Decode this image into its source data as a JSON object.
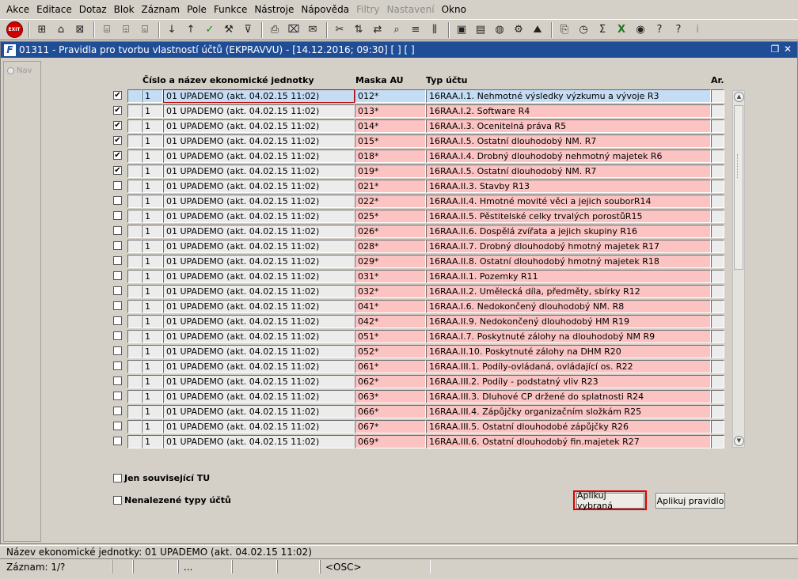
{
  "menu": [
    "Akce",
    "Editace",
    "Dotaz",
    "Blok",
    "Záznam",
    "Pole",
    "Funkce",
    "Nástroje",
    "Nápověda",
    "Filtry",
    "Nastavení",
    "Okno"
  ],
  "menu_disabled": [
    "Filtry",
    "Nastavení"
  ],
  "toolbar": {
    "exit_label": "EXIT"
  },
  "window": {
    "title": "01311 - Pravidla pro tvorbu vlastností účtů (EKPRAVVU) - [14.12.2016; 09:30] [ ] [ ]",
    "nav_label": "Nav"
  },
  "grid": {
    "columns": {
      "unit": "Číslo a název ekonomické jednotky",
      "mask": "Maska AU",
      "type": "Typ účtu",
      "ar": "Ar."
    },
    "rows": [
      {
        "checked": true,
        "num": "1",
        "unit": "01 UPADEMO (akt. 04.02.15 11:02)",
        "mask": "012*",
        "type": "16RAA.I.1.  Nehmotné výsledky výzkumu a vývoje R3"
      },
      {
        "checked": true,
        "num": "1",
        "unit": "01 UPADEMO (akt. 04.02.15 11:02)",
        "mask": "013*",
        "type": "16RAA.I.2.  Software R4"
      },
      {
        "checked": true,
        "num": "1",
        "unit": "01 UPADEMO (akt. 04.02.15 11:02)",
        "mask": "014*",
        "type": "16RAA.I.3.  Ocenitelná práva R5"
      },
      {
        "checked": true,
        "num": "1",
        "unit": "01 UPADEMO (akt. 04.02.15 11:02)",
        "mask": "015*",
        "type": "16RAA.I.5.  Ostatní dlouhodobý NM. R7"
      },
      {
        "checked": true,
        "num": "1",
        "unit": "01 UPADEMO (akt. 04.02.15 11:02)",
        "mask": "018*",
        "type": "16RAA.I.4.  Drobný dlouhodobý nehmotný majetek R6"
      },
      {
        "checked": true,
        "num": "1",
        "unit": "01 UPADEMO (akt. 04.02.15 11:02)",
        "mask": "019*",
        "type": "16RAA.I.5.  Ostatní dlouhodobý NM. R7"
      },
      {
        "checked": false,
        "num": "1",
        "unit": "01 UPADEMO (akt. 04.02.15 11:02)",
        "mask": "021*",
        "type": "16RAA.II.3.  Stavby R13"
      },
      {
        "checked": false,
        "num": "1",
        "unit": "01 UPADEMO (akt. 04.02.15 11:02)",
        "mask": "022*",
        "type": "16RAA.II.4.  Hmotné movité věci a jejich souborR14"
      },
      {
        "checked": false,
        "num": "1",
        "unit": "01 UPADEMO (akt. 04.02.15 11:02)",
        "mask": "025*",
        "type": "16RAA.II.5.  Pěstitelské celky trvalých porostůR15"
      },
      {
        "checked": false,
        "num": "1",
        "unit": "01 UPADEMO (akt. 04.02.15 11:02)",
        "mask": "026*",
        "type": "16RAA.II.6.  Dospělá zvířata a jejich skupiny R16"
      },
      {
        "checked": false,
        "num": "1",
        "unit": "01 UPADEMO (akt. 04.02.15 11:02)",
        "mask": "028*",
        "type": "16RAA.II.7.  Drobný dlouhodobý hmotný majetek R17"
      },
      {
        "checked": false,
        "num": "1",
        "unit": "01 UPADEMO (akt. 04.02.15 11:02)",
        "mask": "029*",
        "type": "16RAA.II.8.  Ostatní dlouhodobý hmotný majetek R18"
      },
      {
        "checked": false,
        "num": "1",
        "unit": "01 UPADEMO (akt. 04.02.15 11:02)",
        "mask": "031*",
        "type": "16RAA.II.1.  Pozemky R11"
      },
      {
        "checked": false,
        "num": "1",
        "unit": "01 UPADEMO (akt. 04.02.15 11:02)",
        "mask": "032*",
        "type": "16RAA.II.2.  Umělecká díla, předměty, sbírky R12"
      },
      {
        "checked": false,
        "num": "1",
        "unit": "01 UPADEMO (akt. 04.02.15 11:02)",
        "mask": "041*",
        "type": "16RAA.I.6.  Nedokončený dlouhodobý NM. R8"
      },
      {
        "checked": false,
        "num": "1",
        "unit": "01 UPADEMO (akt. 04.02.15 11:02)",
        "mask": "042*",
        "type": "16RAA.II.9.  Nedokončený dlouhodobý HM R19"
      },
      {
        "checked": false,
        "num": "1",
        "unit": "01 UPADEMO (akt. 04.02.15 11:02)",
        "mask": "051*",
        "type": "16RAA.I.7.  Poskytnuté zálohy na dlouhodobý NM R9"
      },
      {
        "checked": false,
        "num": "1",
        "unit": "01 UPADEMO (akt. 04.02.15 11:02)",
        "mask": "052*",
        "type": "16RAA.II.10.  Poskytnuté zálohy na DHM R20"
      },
      {
        "checked": false,
        "num": "1",
        "unit": "01 UPADEMO (akt. 04.02.15 11:02)",
        "mask": "061*",
        "type": "16RAA.III.1.  Podíly-ovládaná, ovládající os. R22"
      },
      {
        "checked": false,
        "num": "1",
        "unit": "01 UPADEMO (akt. 04.02.15 11:02)",
        "mask": "062*",
        "type": "16RAA.III.2.  Podíly - podstatný vliv R23"
      },
      {
        "checked": false,
        "num": "1",
        "unit": "01 UPADEMO (akt. 04.02.15 11:02)",
        "mask": "063*",
        "type": "16RAA.III.3.  Dluhové CP držené do splatnosti R24"
      },
      {
        "checked": false,
        "num": "1",
        "unit": "01 UPADEMO (akt. 04.02.15 11:02)",
        "mask": "066*",
        "type": "16RAA.III.4.  Zápůjčky organizačním složkám R25"
      },
      {
        "checked": false,
        "num": "1",
        "unit": "01 UPADEMO (akt. 04.02.15 11:02)",
        "mask": "067*",
        "type": "16RAA.III.5.  Ostatní dlouhodobé zápůjčky R26"
      },
      {
        "checked": false,
        "num": "1",
        "unit": "01 UPADEMO (akt. 04.02.15 11:02)",
        "mask": "069*",
        "type": "16RAA.III.6.  Ostatní dlouhodobý fin.majetek R27"
      }
    ]
  },
  "options": {
    "related_label": "Jen související TU",
    "found_label": "Nenalezené  typy účtů"
  },
  "buttons": {
    "apply_selected": "Aplikuj vybraná",
    "apply_rule": "Aplikuj pravidlo"
  },
  "status": {
    "line1": "Název ekonomické jednotky: 01 UPADEMO (akt. 04.02.15 11:02)",
    "record": "Záznam: 1/?",
    "seg_dots": "...",
    "osc": "<OSC>"
  },
  "colors": {
    "title_bar": "#1f4e96",
    "pink_cell": "#fcc3c3",
    "selected_cell": "#c4dcf4",
    "highlight_frame": "#e00000"
  }
}
